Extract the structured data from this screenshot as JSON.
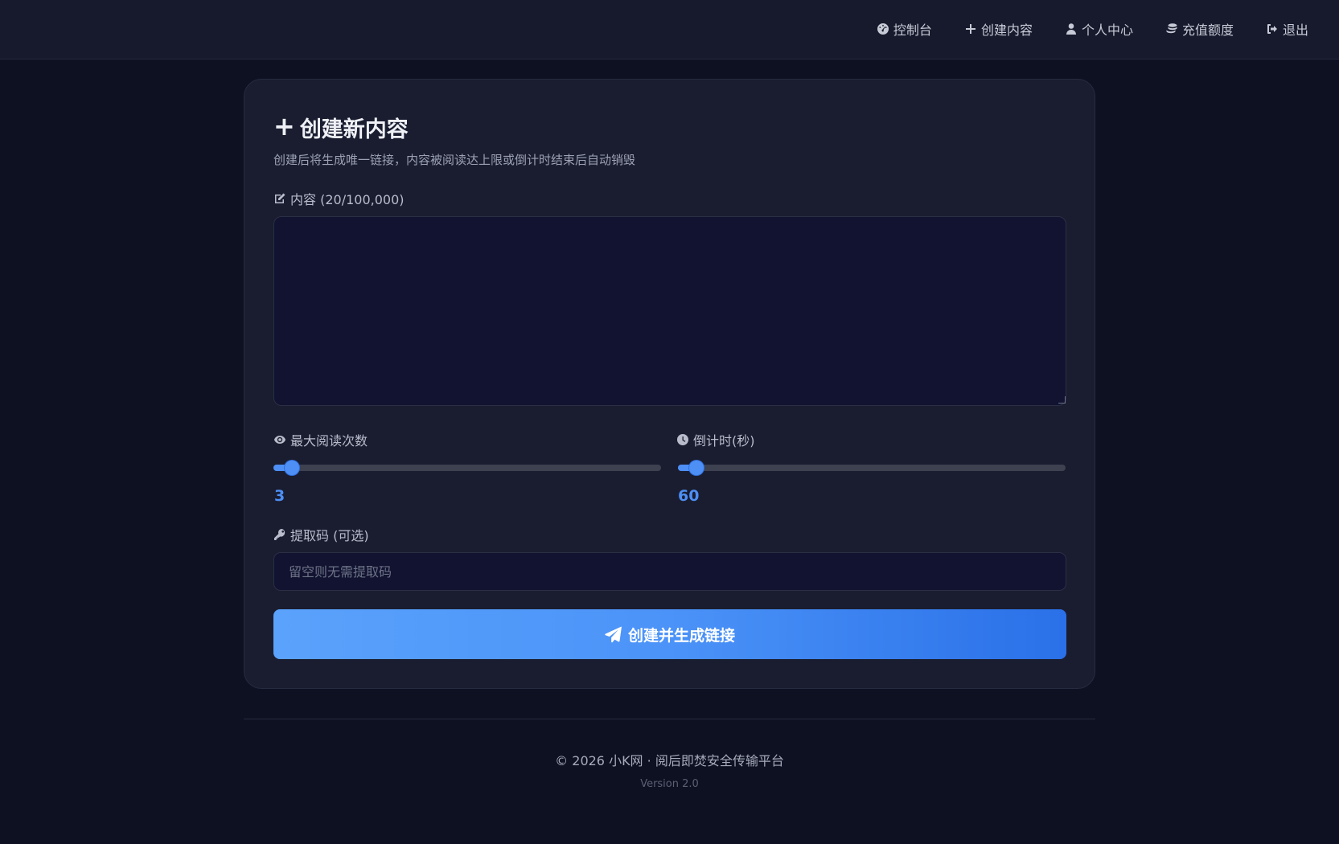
{
  "nav": {
    "items": [
      {
        "label": "控制台",
        "icon": "dashboard-icon"
      },
      {
        "label": "创建内容",
        "icon": "plus-icon"
      },
      {
        "label": "个人中心",
        "icon": "user-icon"
      },
      {
        "label": "充值额度",
        "icon": "coins-icon"
      },
      {
        "label": "退出",
        "icon": "sign-out-icon"
      }
    ]
  },
  "card": {
    "title": "创建新内容",
    "subtitle": "创建后将生成唯一链接，内容被阅读达上限或倒计时结束后自动销毁"
  },
  "content_field": {
    "label": "内容 (20/100,000)",
    "value": ""
  },
  "max_reads": {
    "label": "最大阅读次数",
    "value": "3",
    "fraction": 0.03
  },
  "countdown": {
    "label": "倒计时(秒)",
    "value": "60",
    "fraction": 0.03
  },
  "code_field": {
    "label": "提取码 (可选)",
    "placeholder": "留空则无需提取码"
  },
  "submit": {
    "label": "创建并生成链接"
  },
  "footer": {
    "copyright": "© 2026 小K网 · 阅后即焚安全传输平台",
    "version": "Version 2.0"
  },
  "colors": {
    "background": "#0e1122",
    "card": "#1a1d30",
    "accent": "#4d8ff5"
  }
}
